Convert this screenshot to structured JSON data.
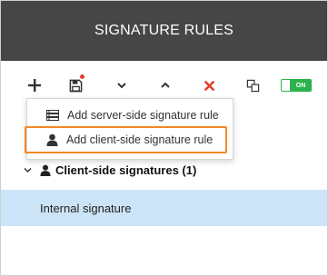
{
  "header": {
    "title": "SIGNATURE RULES"
  },
  "toolbar": {
    "add_icon": "plus-icon",
    "save_icon": "floppy-disk-icon",
    "move_down_icon": "chevron-down-icon",
    "move_up_icon": "chevron-up-icon",
    "delete_icon": "close-x-icon",
    "copy_icon": "copy-icon",
    "toggle_label": "ON",
    "colors": {
      "delete": "#e2402b",
      "toggle": "#2bb24c",
      "unsaved_dot": "#e2402b"
    }
  },
  "add_menu": {
    "items": [
      {
        "label": "Add server-side signature rule",
        "icon": "server-icon"
      },
      {
        "label": "Add client-side signature rule",
        "icon": "user-icon",
        "highlight": "#f08a24"
      }
    ]
  },
  "groups": [
    {
      "label": "Client-side signatures (1)",
      "icon": "user-icon",
      "expanded": true,
      "items": [
        {
          "label": "Internal signature",
          "selected": true
        }
      ]
    }
  ],
  "colors": {
    "header_bg": "#464646",
    "selected_row_bg": "#cce4f7"
  }
}
